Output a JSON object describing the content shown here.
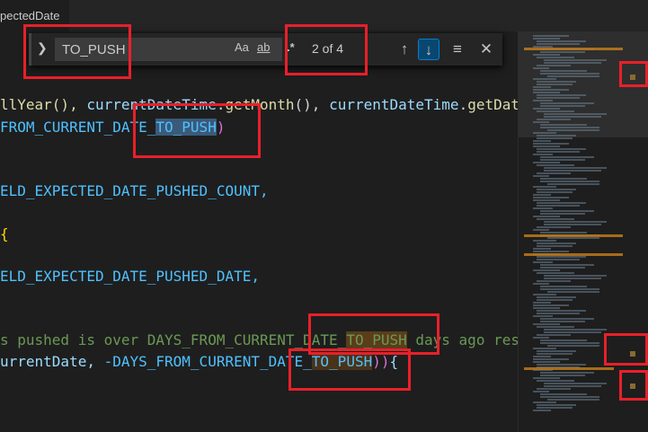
{
  "tab": {
    "title": "pectedDate"
  },
  "find": {
    "toggle_icon": "chevron-right",
    "query": "TO_PUSH",
    "match_case_label": "Aa",
    "whole_word_label": "ab",
    "regex_label": ".*",
    "count": "2 of 4",
    "prev_icon": "arrow-up",
    "next_icon": "arrow-down",
    "selection_icon": "lines",
    "close_icon": "close"
  },
  "code": {
    "l1a": "llYear(), ",
    "l1b": "currentDateTime",
    "l1c": ".",
    "l1d": "getMonth",
    "l1e": "(), ",
    "l1f": "currentDateTime",
    "l1g": ".",
    "l1h": "getDat",
    "l2a": "FROM_CURRENT_DATE_",
    "l2b": "TO_PUSH",
    "l2c": ")",
    "l3": "ELD_EXPECTED_DATE_PUSHED_COUNT,",
    "l4": "{",
    "l5": "ELD_EXPECTED_DATE_PUSHED_DATE,",
    "l6a": "s pushed is over DAYS_FROM_CURRENT_DATE_",
    "l6b": "TO_PUSH",
    "l6c": " days ago res",
    "l7a": "urrentDate, ",
    "l7b": "-DAYS_FROM_CURRENT_DATE_",
    "l7c": "TO_PUSH",
    "l7d": "))",
    "l7e": "{"
  },
  "colors": {
    "annotation": "#e8202a",
    "find_match": "#5a3d1a",
    "current_match": "#3a5a7a"
  }
}
